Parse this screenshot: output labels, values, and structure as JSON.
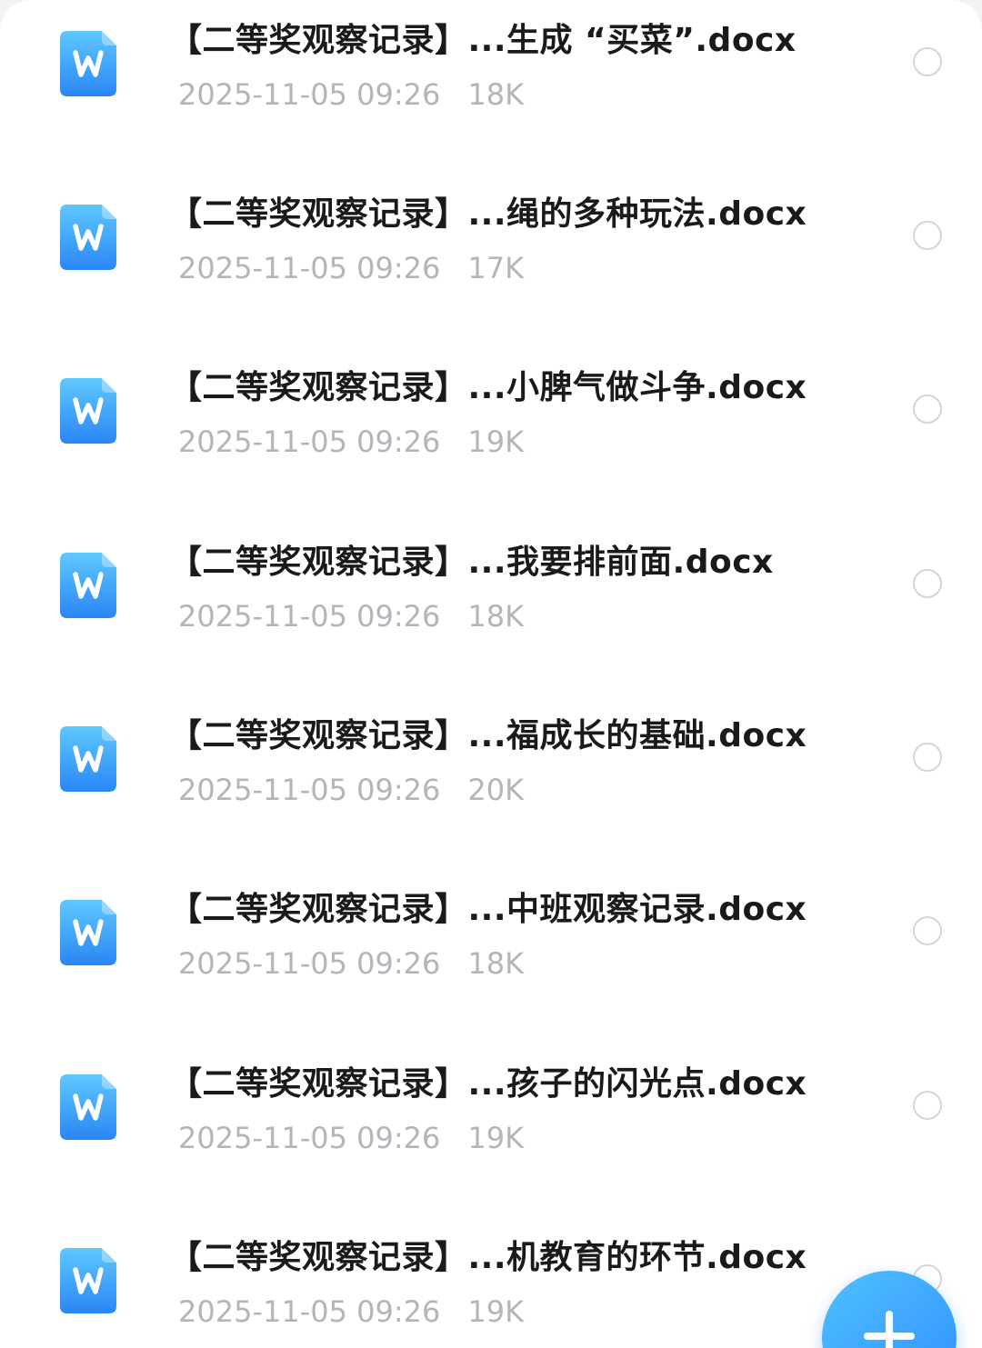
{
  "files": [
    {
      "name": "【二等奖观察记录】...生成 “买菜”.docx",
      "date": "2025-11-05 09:26",
      "size": "18K",
      "icon": "word-doc-icon"
    },
    {
      "name": "【二等奖观察记录】...绳的多种玩法.docx",
      "date": "2025-11-05 09:26",
      "size": "17K",
      "icon": "word-doc-icon"
    },
    {
      "name": "【二等奖观察记录】...小脾气做斗争.docx",
      "date": "2025-11-05 09:26",
      "size": "19K",
      "icon": "word-doc-icon"
    },
    {
      "name": "【二等奖观察记录】...我要排前面.docx",
      "date": "2025-11-05 09:26",
      "size": "18K",
      "icon": "word-doc-icon"
    },
    {
      "name": "【二等奖观察记录】...福成长的基础.docx",
      "date": "2025-11-05 09:26",
      "size": "20K",
      "icon": "word-doc-icon"
    },
    {
      "name": "【二等奖观察记录】...中班观察记录.docx",
      "date": "2025-11-05 09:26",
      "size": "18K",
      "icon": "word-doc-icon"
    },
    {
      "name": "【二等奖观察记录】...孩子的闪光点.docx",
      "date": "2025-11-05 09:26",
      "size": "19K",
      "icon": "word-doc-icon"
    },
    {
      "name": "【二等奖观察记录】...机教育的环节.docx",
      "date": "2025-11-05 09:26",
      "size": "19K",
      "icon": "word-doc-icon"
    }
  ],
  "fab": {
    "icon": "plus-icon"
  },
  "colors": {
    "accent": "#2f8fff",
    "icon_gradient_start": "#5fc8ff",
    "icon_gradient_end": "#2a86f5",
    "title_text": "#1a1a1a",
    "meta_text": "#b3b5ba",
    "radio_border": "#d3d5da"
  }
}
